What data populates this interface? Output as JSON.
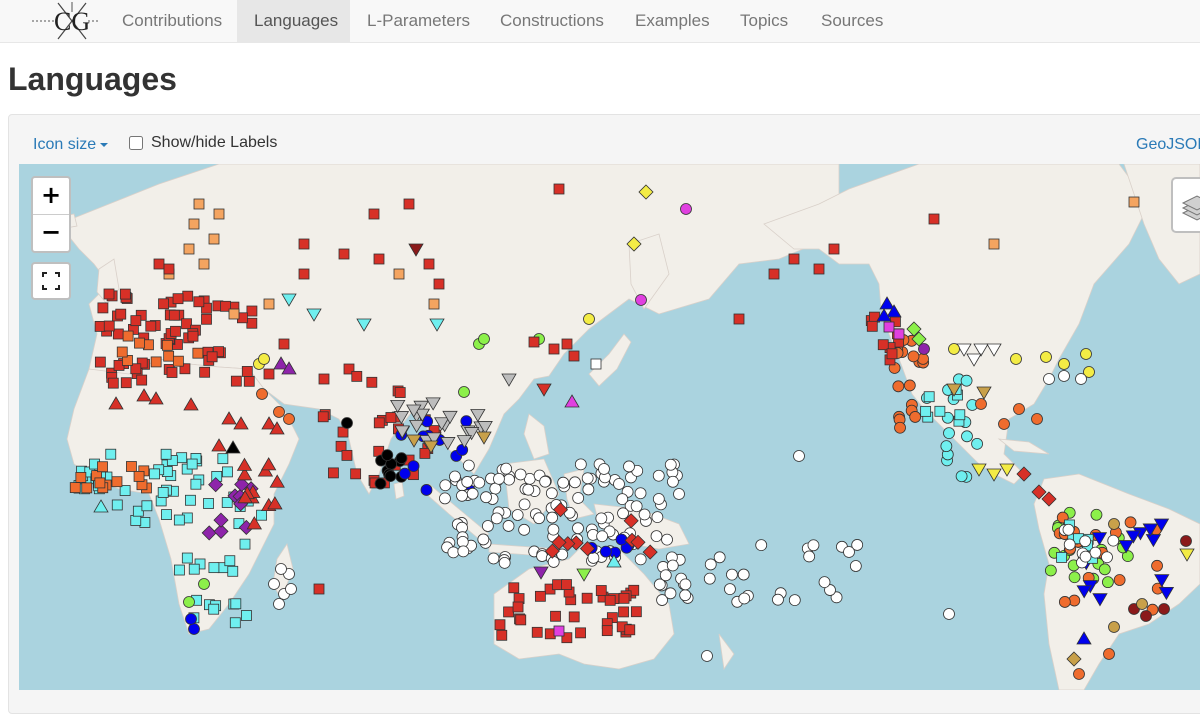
{
  "nav": {
    "brand": "CG",
    "items": [
      {
        "label": "Contributions",
        "active": false
      },
      {
        "label": "Languages",
        "active": true
      },
      {
        "label": "L-Parameters",
        "active": false
      },
      {
        "label": "Constructions",
        "active": false
      },
      {
        "label": "Examples",
        "active": false
      },
      {
        "label": "Topics",
        "active": false
      },
      {
        "label": "Sources",
        "active": false
      }
    ]
  },
  "page": {
    "title": "Languages"
  },
  "map_toolbar": {
    "icon_size_label": "Icon size",
    "labels_toggle_label": "Show/hide Labels",
    "labels_checked": false,
    "geojson_label": "GeoJSON"
  },
  "map": {
    "zoom_in": "+",
    "zoom_out": "−",
    "marker_colors": {
      "red": "#d73027",
      "orange": "#ef6c2e",
      "light_orange": "#f4a460",
      "cyan": "#6fefef",
      "white": "#ffffff",
      "black": "#000000",
      "blue": "#0000ee",
      "purple": "#8e24aa",
      "green": "#8cf04a",
      "yellow": "#f3ec45",
      "grey": "#bdbdbd",
      "tan": "#c8a04a",
      "magenta": "#e040e0",
      "brown": "#8b1a1a"
    }
  }
}
